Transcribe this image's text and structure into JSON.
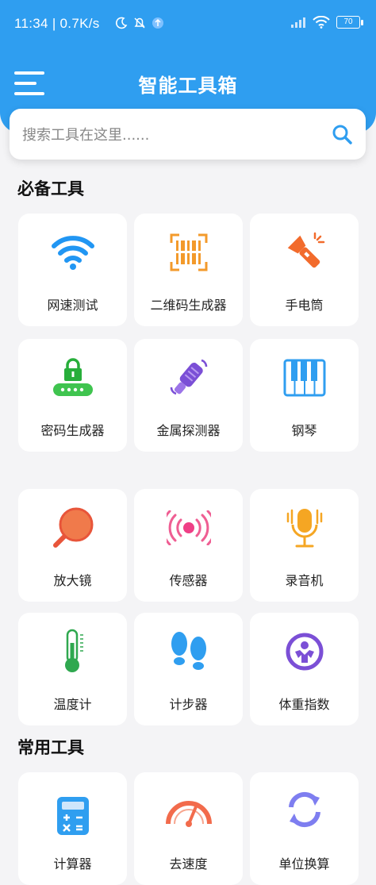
{
  "status_bar": {
    "time": "11:34",
    "speed": "| 0.7K/s",
    "battery": "70",
    "icons": [
      "moon-icon",
      "silent-bell-icon",
      "upload-icon",
      "signal-icon",
      "wifi-icon",
      "battery-icon"
    ]
  },
  "header": {
    "title": "智能工具箱",
    "menu_icon": "hamburger-icon",
    "color": "#2f9ef0"
  },
  "search": {
    "placeholder": "搜索工具在这里......",
    "icon": "search-icon"
  },
  "sections": [
    {
      "title": "必备工具",
      "items": [
        {
          "label": "网速测试",
          "icon": "wifi-icon"
        },
        {
          "label": "二维码生成器",
          "icon": "barcode-icon"
        },
        {
          "label": "手电筒",
          "icon": "flashlight-icon"
        },
        {
          "label": "密码生成器",
          "icon": "lock-icon"
        },
        {
          "label": "金属探测器",
          "icon": "metal-detector-icon"
        },
        {
          "label": "钢琴",
          "icon": "piano-icon"
        },
        {
          "label": "放大镜",
          "icon": "magnifier-icon"
        },
        {
          "label": "传感器",
          "icon": "sensor-icon"
        },
        {
          "label": "录音机",
          "icon": "microphone-icon"
        },
        {
          "label": "温度计",
          "icon": "thermometer-icon"
        },
        {
          "label": "计步器",
          "icon": "footsteps-icon"
        },
        {
          "label": "体重指数",
          "icon": "weight-scale-icon"
        }
      ]
    },
    {
      "title": "常用工具",
      "items": [
        {
          "label": "计算器",
          "icon": "calculator-icon"
        },
        {
          "label": "去速度",
          "icon": "speedometer-icon"
        },
        {
          "label": "单位换算",
          "icon": "convert-icon"
        }
      ]
    }
  ]
}
